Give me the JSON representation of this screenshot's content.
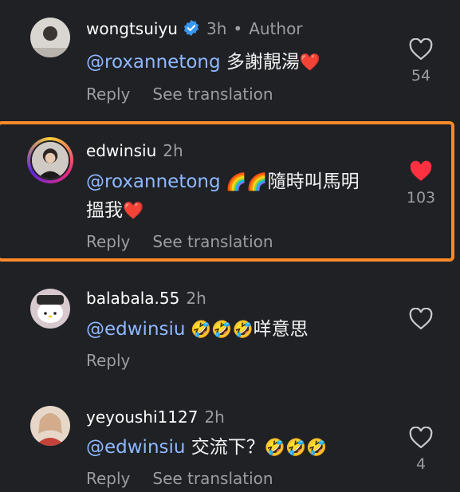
{
  "comments": [
    {
      "username": "wongtsuiyu",
      "verified": true,
      "time": "3h",
      "author_label": "Author",
      "mention": "@roxannetong",
      "text": " 多謝靚湯",
      "emoji_suffix": "❤️",
      "reply_label": "Reply",
      "translate_label": "See translation",
      "liked": false,
      "like_count": "54"
    },
    {
      "username": "edwinsiu",
      "time": "2h",
      "mention": "@roxannetong",
      "text_line1_emoji": " 🌈🌈",
      "text_line1": "隨時叫馬明",
      "text_line2": "搵我",
      "emoji_suffix": "❤️",
      "reply_label": "Reply",
      "translate_label": "See translation",
      "liked": true,
      "like_count": "103"
    },
    {
      "username": "balabala.55",
      "time": "2h",
      "mention": "@edwinsiu",
      "emoji": " 🤣🤣🤣",
      "text": "咩意思",
      "reply_label": "Reply",
      "liked": false,
      "like_count": ""
    },
    {
      "username": "yeyoushi1127",
      "time": "2h",
      "mention": "@edwinsiu",
      "text": " 交流下？",
      "emoji": "🤣🤣🤣",
      "reply_label": "Reply",
      "translate_label": "See translation",
      "liked": false,
      "like_count": "4"
    }
  ],
  "colors": {
    "background": "#1f2125",
    "mention": "#8fb8ff",
    "secondary_text": "#9b9da2",
    "liked_heart": "#ff3040",
    "highlight_border": "#ff8a2a",
    "verified_badge": "#3897f0"
  },
  "icons": [
    "heart-outline-icon",
    "heart-filled-icon",
    "verified-badge-icon"
  ]
}
